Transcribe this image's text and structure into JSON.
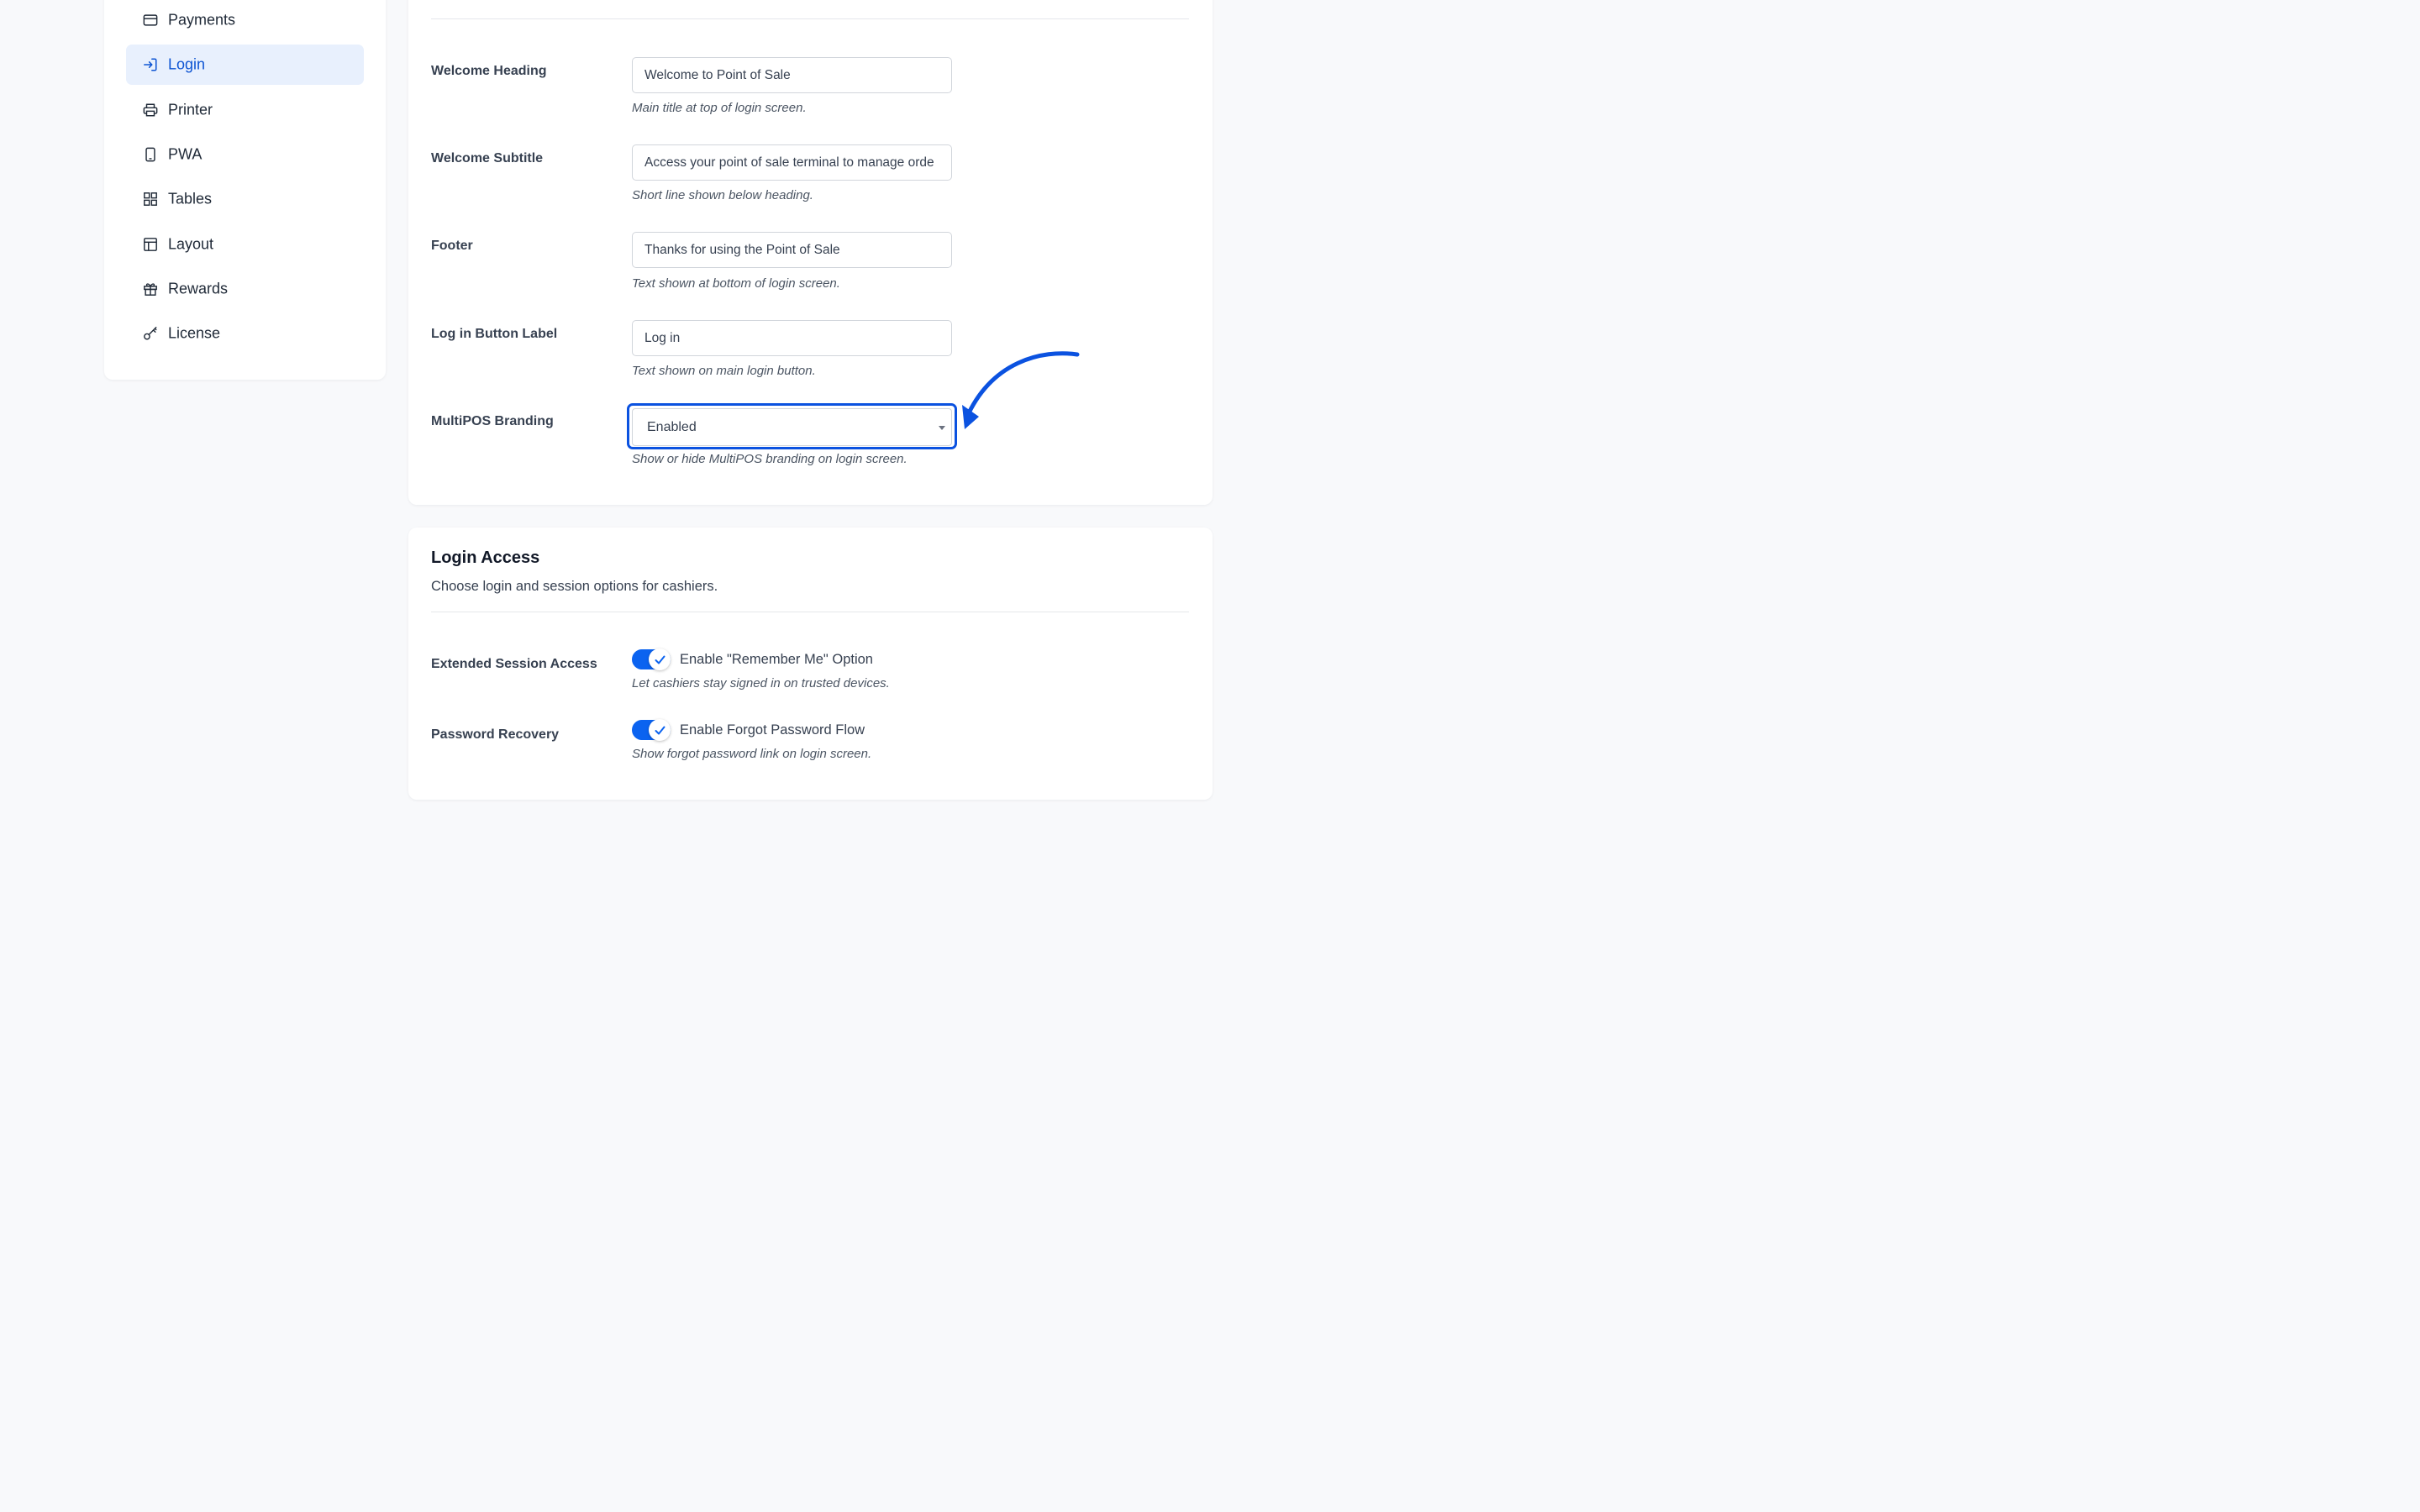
{
  "sidebar": {
    "items": [
      {
        "label": "Payments",
        "icon": "credit-card-icon"
      },
      {
        "label": "Login",
        "icon": "login-icon",
        "active": true
      },
      {
        "label": "Printer",
        "icon": "printer-icon"
      },
      {
        "label": "PWA",
        "icon": "mobile-device-icon"
      },
      {
        "label": "Tables",
        "icon": "grid-icon"
      },
      {
        "label": "Layout",
        "icon": "layout-icon"
      },
      {
        "label": "Rewards",
        "icon": "gift-icon"
      },
      {
        "label": "License",
        "icon": "key-icon"
      }
    ]
  },
  "login_screen": {
    "fields": [
      {
        "label": "Welcome Heading",
        "value": "Welcome to Point of Sale",
        "help": "Main title at top of login screen."
      },
      {
        "label": "Welcome Subtitle",
        "value": "Access your point of sale terminal to manage orde",
        "help": "Short line shown below heading."
      },
      {
        "label": "Footer",
        "value": "Thanks for using the Point of Sale",
        "help": "Text shown at bottom of login screen."
      },
      {
        "label": "Log in Button Label",
        "value": "Log in",
        "help": "Text shown on main login button."
      }
    ],
    "branding": {
      "label": "MultiPOS Branding",
      "selected": "Enabled",
      "help": "Show or hide MultiPOS branding on login screen."
    }
  },
  "login_access": {
    "title": "Login Access",
    "subtitle": "Choose login and session options for cashiers.",
    "options": [
      {
        "label": "Extended Session Access",
        "toggle_text": "Enable \"Remember Me\" Option",
        "help": "Let cashiers stay signed in on trusted devices.",
        "enabled": true
      },
      {
        "label": "Password Recovery",
        "toggle_text": "Enable Forgot Password Flow",
        "help": "Show forgot password link on login screen.",
        "enabled": true
      }
    ]
  },
  "colors": {
    "accent": "#0b52e0",
    "active_bg": "#e8f0fd",
    "toggle_on": "#0b63f0",
    "page_bg": "#f8f9fb"
  }
}
